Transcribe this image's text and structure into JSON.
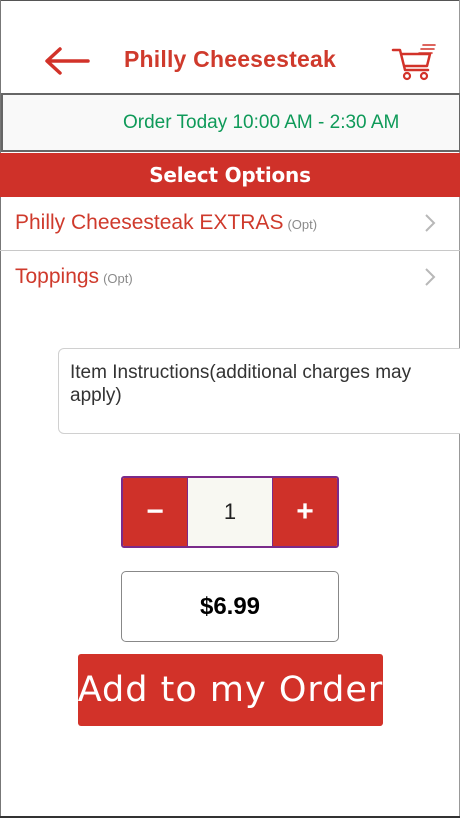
{
  "header": {
    "title": "Philly Cheesesteak",
    "back_icon": "arrow-left-icon",
    "cart_icon": "shopping-cart-icon"
  },
  "hours": {
    "text": "Order Today 10:00 AM - 2:30 AM"
  },
  "options": {
    "section_title": "Select Options",
    "items": [
      {
        "label": "Philly Cheesesteak EXTRAS",
        "tag": "(Opt)"
      },
      {
        "label": "Toppings",
        "tag": "(Opt)"
      }
    ]
  },
  "instructions": {
    "placeholder": "Item Instructions(additional charges may apply)"
  },
  "quantity": {
    "minus_label": "−",
    "value": "1",
    "plus_label": "+"
  },
  "price": "$6.99",
  "add_button_label": "Add to my Order",
  "colors": {
    "brand_red": "#cf3129",
    "hours_green": "#0f9a59"
  }
}
